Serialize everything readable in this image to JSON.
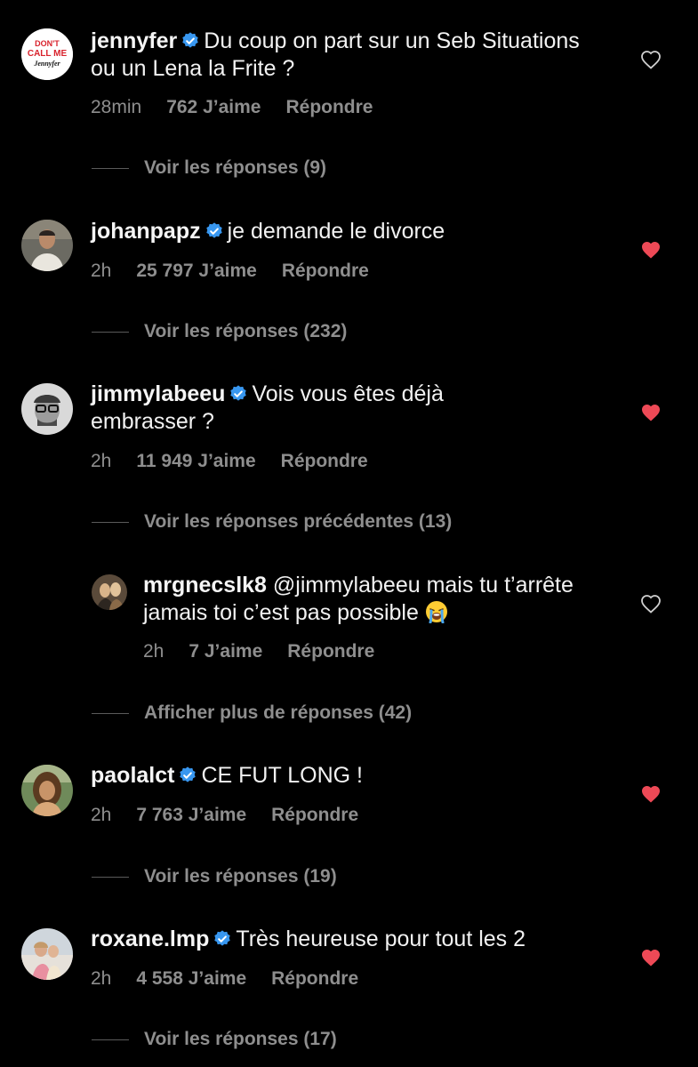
{
  "colors": {
    "background": "#000000",
    "text": "#f2f2f2",
    "muted": "#8e8e8e",
    "verified": "#3897f0",
    "heart_liked": "#ed4956"
  },
  "comments": [
    {
      "username": "jennyfer",
      "verified": true,
      "text": "Du coup on part sur un Seb Situations ou un Lena la Frite ?",
      "time": "28min",
      "likes": "762 J’aime",
      "reply": "Répondre",
      "liked": false,
      "view_replies": "Voir les réponses (9)",
      "avatar_text_1": "DON'T",
      "avatar_text_2": "CALL ME",
      "avatar_text_3": "Jennyfer"
    },
    {
      "username": "johanpapz",
      "verified": true,
      "text": "je demande le divorce",
      "time": "2h",
      "likes": "25 797 J’aime",
      "reply": "Répondre",
      "liked": true,
      "view_replies": "Voir les réponses (232)"
    },
    {
      "username": "jimmylabeeu",
      "verified": true,
      "text": "Vois vous êtes déjà embrasser ?",
      "time": "2h",
      "likes": "11 949 J’aime",
      "reply": "Répondre",
      "liked": true,
      "view_replies": "Voir les réponses précédentes (13)"
    },
    {
      "username": "paolalct",
      "verified": true,
      "text": "CE FUT LONG !",
      "time": "2h",
      "likes": "7 763 J’aime",
      "reply": "Répondre",
      "liked": true,
      "view_replies": "Voir les réponses (19)"
    },
    {
      "username": "roxane.lmp",
      "verified": true,
      "text": "Très heureuse pour tout les 2",
      "time": "2h",
      "likes": "4 558 J’aime",
      "reply": "Répondre",
      "liked": true,
      "view_replies": "Voir les réponses (17)"
    }
  ],
  "reply": {
    "username": "mrgnecslk8",
    "text": "@jimmylabeeu mais tu t’arrête jamais toi c’est pas possible",
    "emoji": "loudly-crying-face-icon",
    "time": "2h",
    "likes": "7 J’aime",
    "reply": "Répondre",
    "liked": false,
    "more_replies": "Afficher plus de réponses (42)"
  }
}
